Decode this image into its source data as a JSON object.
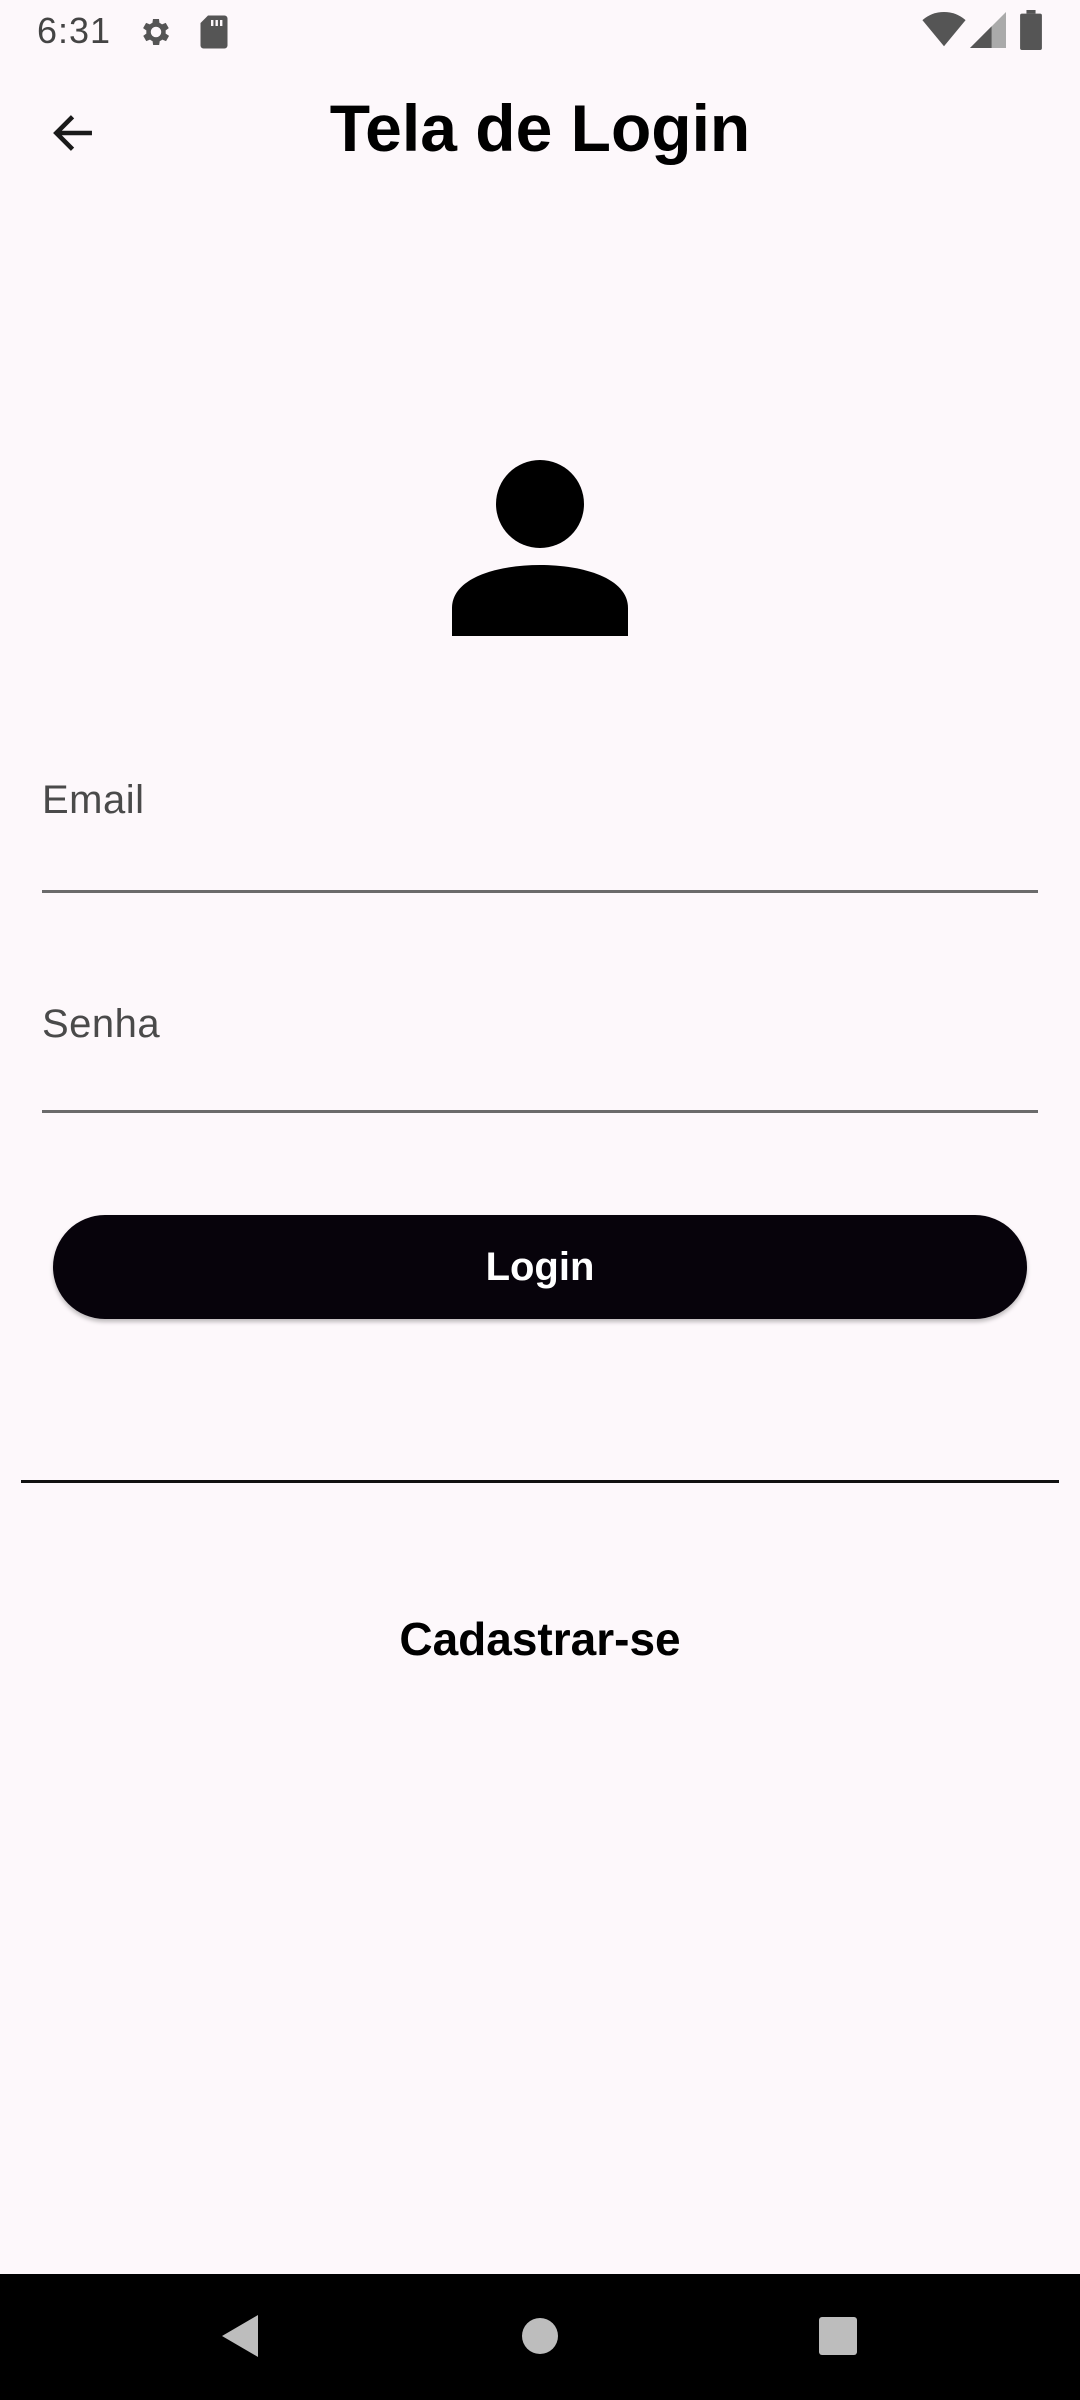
{
  "status_bar": {
    "time": "6:31",
    "icons": [
      "settings-icon",
      "sd-card-icon",
      "wifi-icon",
      "cell-signal-icon",
      "battery-icon"
    ]
  },
  "app_bar": {
    "back_icon": "arrow-back-icon",
    "title": "Tela de Login"
  },
  "avatar": {
    "icon": "person-icon"
  },
  "form": {
    "email_label": "Email",
    "password_label": "Senha",
    "login_label": "Login"
  },
  "register": {
    "label": "Cadastrar-se"
  },
  "nav_bar": {
    "icons": [
      "nav-back-icon",
      "nav-home-icon",
      "nav-recents-icon"
    ]
  },
  "colors": {
    "background": "#fdf8fb",
    "primary_button": "#07030b",
    "field_underline": "#6b6b6b",
    "label_text": "#4a4a4a"
  }
}
